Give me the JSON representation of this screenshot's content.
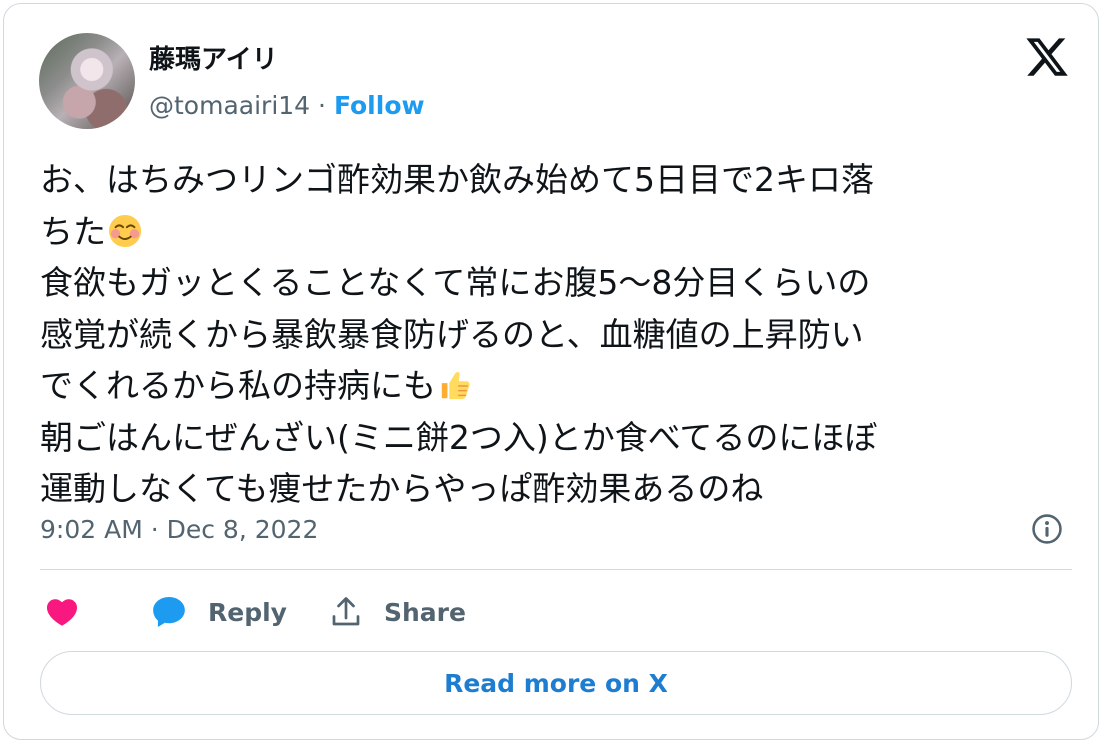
{
  "author": {
    "display_name": "藤瑪アイリ",
    "handle": "@tomaairi14",
    "separator": "·",
    "follow_label": "Follow"
  },
  "tweet": {
    "lines": [
      "お、はちみつリンゴ酢効果か飲み始めて5日目で2キロ落",
      "ちた",
      "食欲もガッとくることなくて常にお腹5〜8分目くらいの",
      "感覚が続くから暴飲暴食防げるのと、血糖値の上昇防い",
      "でくれるから私の持病にも",
      "朝ごはんにぜんざい(ミニ餅2つ入)とか食べてるのにほぼ",
      "運動しなくても痩せたからやっぱ酢効果あるのね"
    ],
    "emojis": [
      "smiling-face-icon",
      "thumbs-up-icon"
    ],
    "timestamp": "9:02 AM · Dec 8, 2022"
  },
  "actions": {
    "reply_label": "Reply",
    "share_label": "Share"
  },
  "read_more_label": "Read more on X",
  "colors": {
    "accent": "#1d9bf0",
    "like": "#f91880",
    "reply_bubble": "#1d9bf0",
    "secondary_text": "#536471",
    "border": "#cfd9de"
  }
}
